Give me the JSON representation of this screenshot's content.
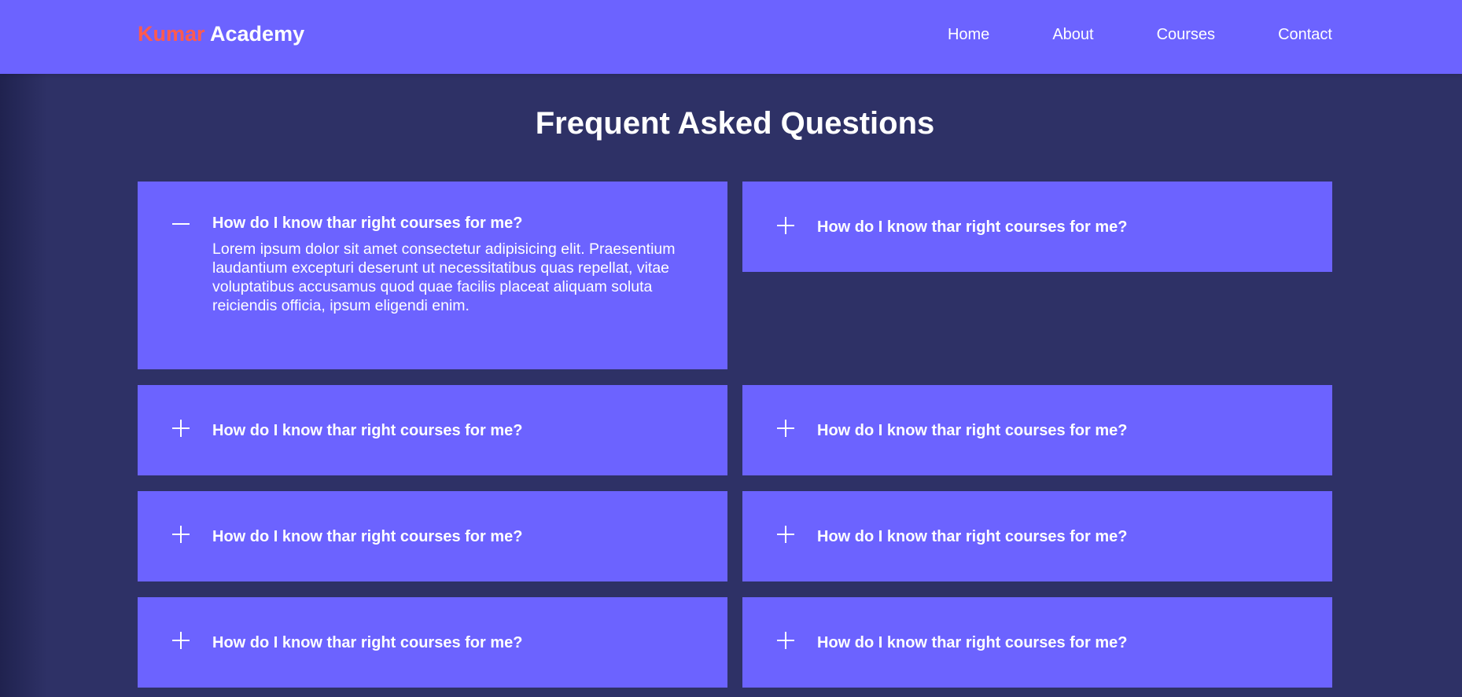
{
  "brand": {
    "first": "Kumar",
    "second": "Academy"
  },
  "nav": {
    "links": [
      "Home",
      "About",
      "Courses",
      "Contact"
    ]
  },
  "faq": {
    "title": "Frequent Asked Questions",
    "items": [
      {
        "question": "How do I know thar right courses for me?",
        "expanded": true,
        "icon": "minus-icon",
        "answer": "Lorem ipsum dolor sit amet consectetur adipisicing elit. Praesentium laudantium excepturi deserunt ut necessitatibus quas repellat, vitae voluptatibus accusamus quod quae facilis placeat aliquam soluta reiciendis officia, ipsum eligendi enim."
      },
      {
        "question": "How do I know thar right courses for me?",
        "expanded": false,
        "icon": "plus-icon"
      },
      {
        "question": "How do I know thar right courses for me?",
        "expanded": false,
        "icon": "plus-icon"
      },
      {
        "question": "How do I know thar right courses for me?",
        "expanded": false,
        "icon": "plus-icon"
      },
      {
        "question": "How do I know thar right courses for me?",
        "expanded": false,
        "icon": "plus-icon"
      },
      {
        "question": "How do I know thar right courses for me?",
        "expanded": false,
        "icon": "plus-icon"
      },
      {
        "question": "How do I know thar right courses for me?",
        "expanded": false,
        "icon": "plus-icon"
      },
      {
        "question": "How do I know thar right courses for me?",
        "expanded": false,
        "icon": "plus-icon"
      }
    ]
  },
  "colors": {
    "primary": "#6c63ff",
    "background": "#2e3166",
    "brand_accent": "#ff5a4e",
    "text": "#ffffff"
  }
}
